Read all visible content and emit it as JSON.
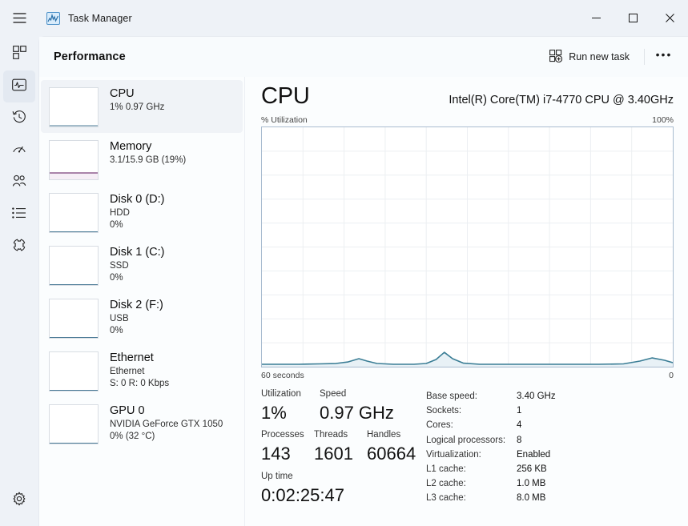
{
  "window": {
    "app_title": "Task Manager",
    "app_icon": "task-manager-chart-icon",
    "menu_icon": "hamburger-menu-icon",
    "minimize_label": "Minimize",
    "maximize_label": "Maximize",
    "close_label": "Close"
  },
  "rail": {
    "items": [
      {
        "name": "processes",
        "icon": "grid-processes-icon",
        "selected": false
      },
      {
        "name": "performance",
        "icon": "pulse-performance-icon",
        "selected": true
      },
      {
        "name": "app-history",
        "icon": "clock-history-icon",
        "selected": false
      },
      {
        "name": "startup-apps",
        "icon": "gauge-startup-icon",
        "selected": false
      },
      {
        "name": "users",
        "icon": "people-users-icon",
        "selected": false
      },
      {
        "name": "details",
        "icon": "list-details-icon",
        "selected": false
      },
      {
        "name": "services",
        "icon": "services-gear-icon",
        "selected": false
      }
    ],
    "settings": {
      "name": "settings",
      "icon": "settings-gear-icon"
    }
  },
  "toolbar": {
    "page_title": "Performance",
    "run_new_task_label": "Run new task",
    "run_new_task_icon": "new-task-grid-plus-icon",
    "more_label": "•••",
    "more_icon": "ellipsis-icon"
  },
  "resources": [
    {
      "name": "CPU",
      "lines": [
        "1%  0.97 GHz"
      ],
      "selected": true,
      "accent": "#4a7a96"
    },
    {
      "name": "Memory",
      "lines": [
        "3.1/15.9 GB (19%)"
      ],
      "selected": false,
      "accent": "#7a3f7a"
    },
    {
      "name": "Disk 0 (D:)",
      "lines": [
        "HDD",
        "0%"
      ],
      "selected": false,
      "accent": "#4a7a96"
    },
    {
      "name": "Disk 1 (C:)",
      "lines": [
        "SSD",
        "0%"
      ],
      "selected": false,
      "accent": "#4a7a96"
    },
    {
      "name": "Disk 2 (F:)",
      "lines": [
        "USB",
        "0%"
      ],
      "selected": false,
      "accent": "#4a7a96"
    },
    {
      "name": "Ethernet",
      "lines": [
        "Ethernet",
        "S: 0 R: 0 Kbps"
      ],
      "selected": false,
      "accent": "#4a7a96"
    },
    {
      "name": "GPU 0",
      "lines": [
        "NVIDIA GeForce GTX 1050",
        "0%  (32 °C)"
      ],
      "selected": false,
      "accent": "#4a7a96"
    }
  ],
  "detail": {
    "title": "CPU",
    "model": "Intel(R) Core(TM) i7-4770 CPU @ 3.40GHz",
    "graph_axis_label": "% Utilization",
    "graph_axis_max": "100%",
    "graph_time_left": "60 seconds",
    "graph_time_right": "0",
    "stats_primary": [
      {
        "label": "Utilization",
        "value": "1%"
      },
      {
        "label": "Speed",
        "value": "0.97 GHz"
      }
    ],
    "stats_secondary": [
      {
        "label": "Processes",
        "value": "143"
      },
      {
        "label": "Threads",
        "value": "1601"
      },
      {
        "label": "Handles",
        "value": "60664"
      }
    ],
    "stats_uptime": {
      "label": "Up time",
      "value": "0:02:25:47"
    },
    "specs": [
      {
        "key": "Base speed:",
        "value": "3.40 GHz"
      },
      {
        "key": "Sockets:",
        "value": "1"
      },
      {
        "key": "Cores:",
        "value": "4"
      },
      {
        "key": "Logical processors:",
        "value": "8"
      },
      {
        "key": "Virtualization:",
        "value": "Enabled"
      },
      {
        "key": "L1 cache:",
        "value": "256 KB"
      },
      {
        "key": "L2 cache:",
        "value": "1.0 MB"
      },
      {
        "key": "L3 cache:",
        "value": "8.0 MB"
      }
    ]
  },
  "chart_data": {
    "type": "line",
    "title": "CPU % Utilization",
    "xlabel": "60 seconds",
    "ylabel": "% Utilization",
    "ylim": [
      0,
      100
    ],
    "xlim": [
      60,
      0
    ],
    "grid": true,
    "grid_columns": 10,
    "grid_rows": 10,
    "line_color": "#3a7d95",
    "fill_color": "#dbeaf2",
    "series": [
      {
        "name": "CPU Utilization",
        "values": [
          1,
          1,
          1,
          1,
          1,
          1,
          1,
          1,
          1,
          1,
          1,
          1,
          1,
          1,
          1,
          2,
          3,
          2,
          1,
          1,
          1,
          1,
          1,
          1,
          1,
          1,
          2,
          4,
          6,
          4,
          2,
          1,
          1,
          1,
          1,
          1,
          1,
          1,
          1,
          1,
          1,
          1,
          1,
          1,
          1,
          1,
          1,
          1,
          1,
          1,
          1,
          1,
          1,
          1,
          1,
          1,
          2,
          3,
          4,
          3
        ]
      }
    ]
  },
  "colors": {
    "accent": "#0f6cbd",
    "chart_line": "#3a7d95",
    "memory_line": "#7a3f7a",
    "window_bg": "#eef2f7",
    "content_bg": "#fbfdfe"
  }
}
